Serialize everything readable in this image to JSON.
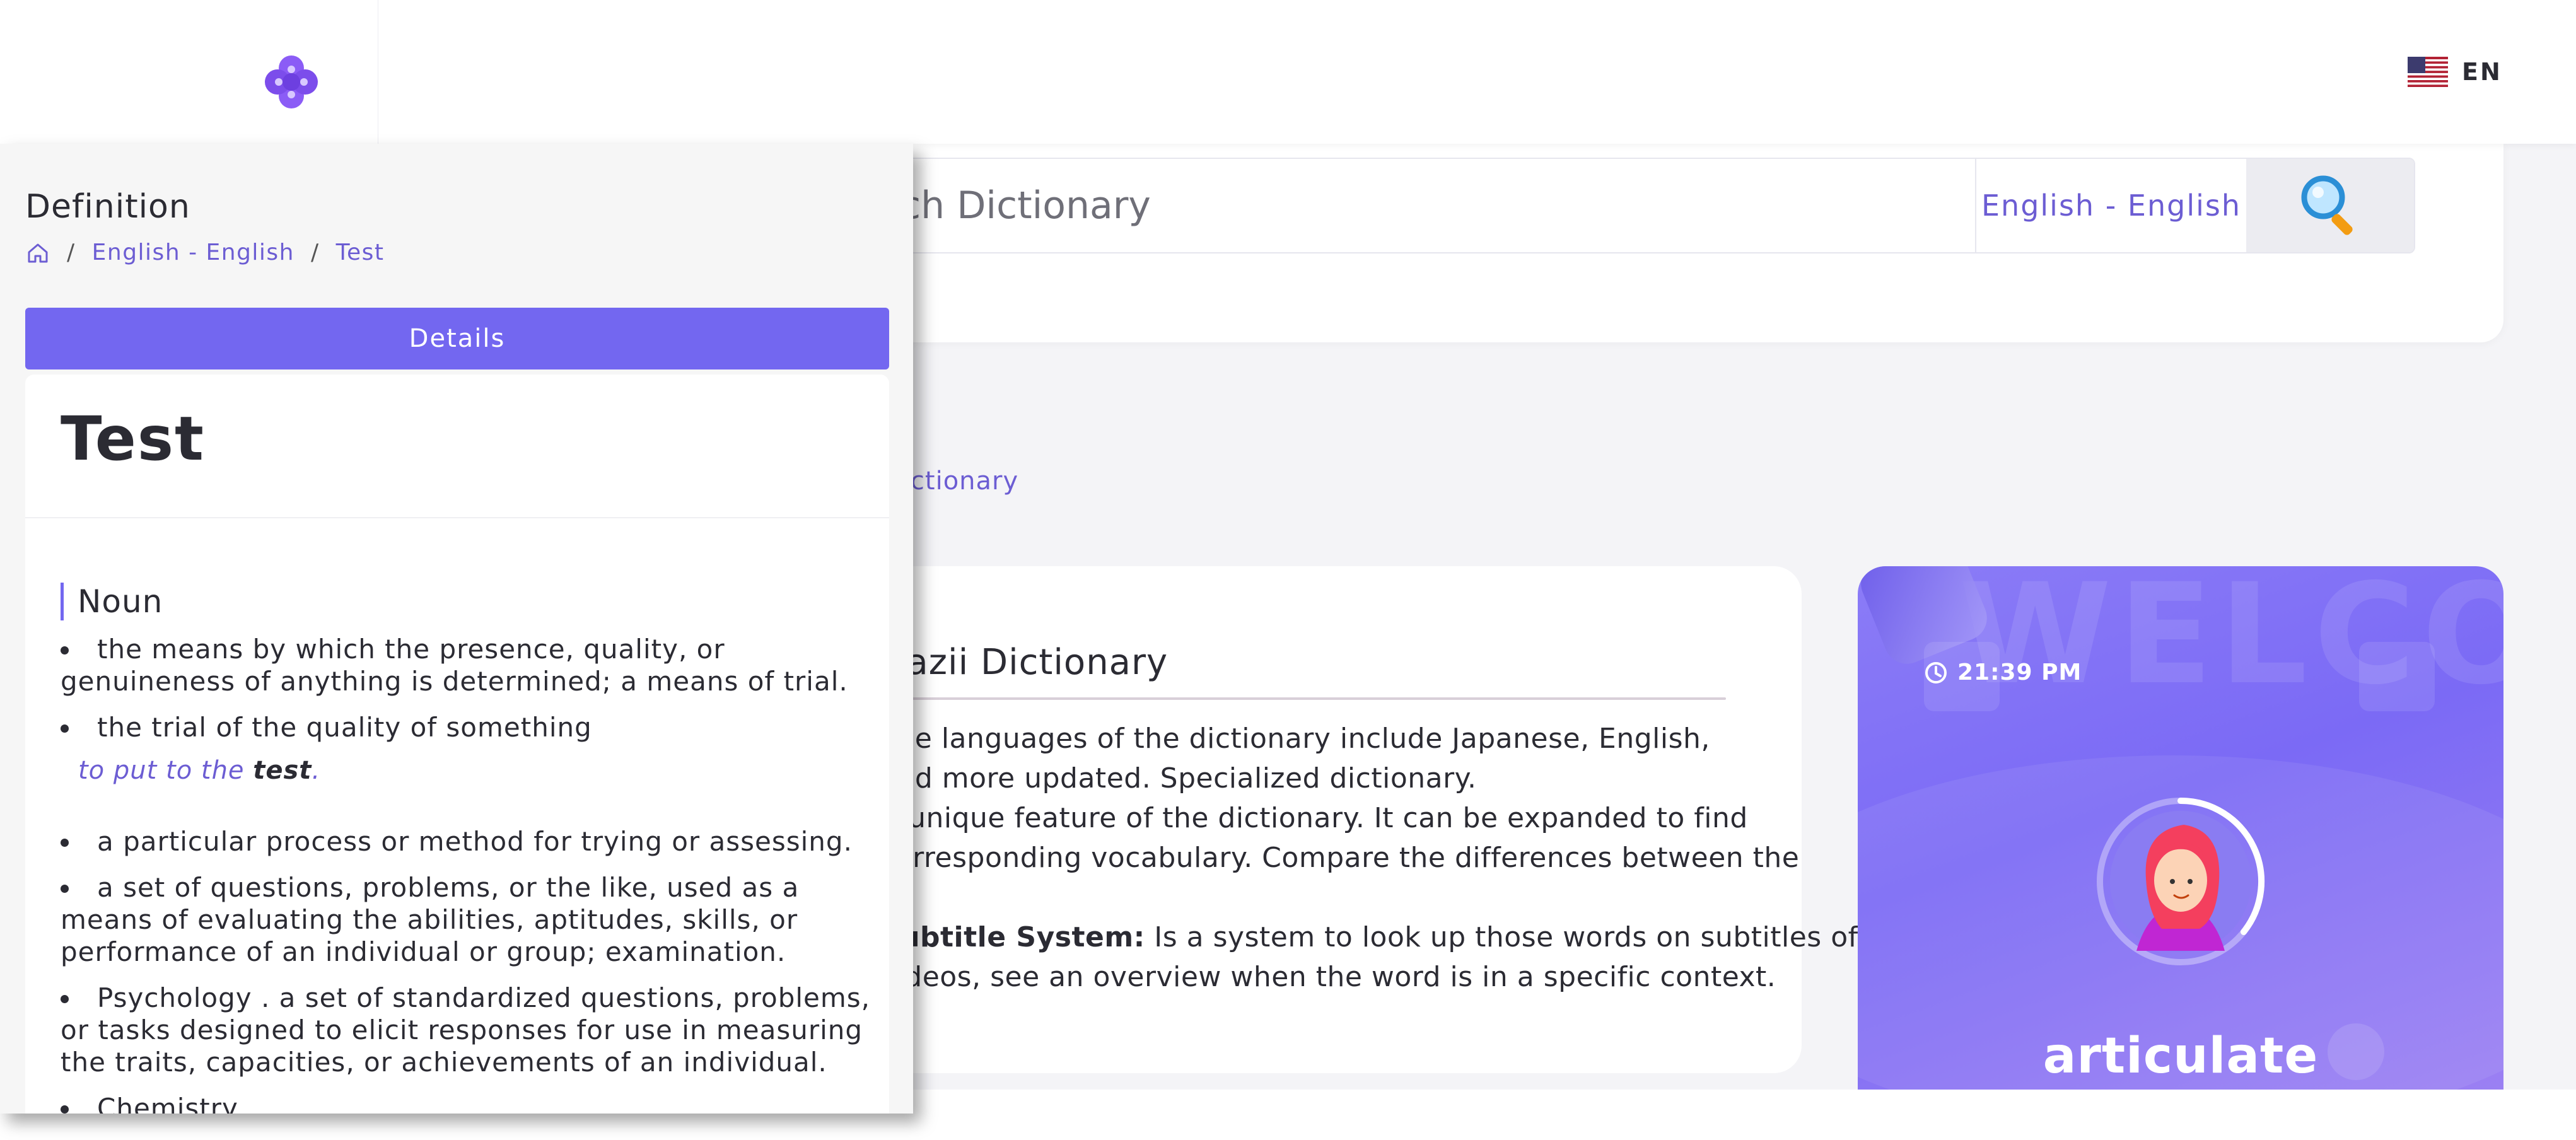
{
  "header": {
    "logo_icon": "flower-logo-icon",
    "language": {
      "flag_icon": "us-flag-icon",
      "code": "EN"
    }
  },
  "search": {
    "placeholder": "Search Dictionary",
    "dictionary_select": "English - English",
    "search_icon": "magnifier-icon"
  },
  "background_page": {
    "breadcrumb_tail": "Dictionary",
    "intro_title": "Mazii Dictionary",
    "intro_paragraphs": [
      {
        "bold": "",
        "text": "The languages of the dictionary include Japanese, English,"
      },
      {
        "bold": "",
        "text": "and more updated. Specialized dictionary."
      },
      {
        "bold": "",
        "text": "A unique feature of the dictionary. It can be expanded to find"
      },
      {
        "bold": "",
        "text": "corresponding vocabulary. Compare the differences between the"
      },
      {
        "bold": "Subtitle System:",
        "text": " Is a system to look up those words on subtitles of"
      },
      {
        "bold": "",
        "text": "videos, see an overview when the word is in a specific context."
      }
    ],
    "promo": {
      "background_word": "WELCOME",
      "time": "21:39 PM",
      "clock_icon": "clock-icon",
      "avatar_icon": "girl-avatar-icon",
      "word": "articulate",
      "accent": "#7b6af5"
    }
  },
  "panel": {
    "title": "Definition",
    "breadcrumb": {
      "home_icon": "home-icon",
      "separator": "/",
      "dictionary": "English - English",
      "word": "Test"
    },
    "details_button": "Details",
    "entry": {
      "word": "Test",
      "part_of_speech": "Noun",
      "senses": [
        {
          "text": "the means by which the presence, quality, or genuineness of anything is determined; a means of trial."
        },
        {
          "text": "the trial of the quality of something",
          "example": {
            "before": "to put to the ",
            "word": "test",
            "after": "."
          }
        },
        {
          "text": "a particular process or method for trying or assessing."
        },
        {
          "text": "a set of questions, problems, or the like, used as a means of evaluating the abilities, aptitudes, skills, or performance of an individual or group; examination."
        },
        {
          "text": "Psychology . a set of standardized questions, problems, or tasks designed to elicit responses for use in measuring the traits, capacities, or achievements of an individual."
        },
        {
          "text": "Chemistry ."
        }
      ]
    }
  },
  "colors": {
    "primary": "#7367f0",
    "link": "#6c5dd3",
    "panel_bg": "#f6f6f6"
  }
}
